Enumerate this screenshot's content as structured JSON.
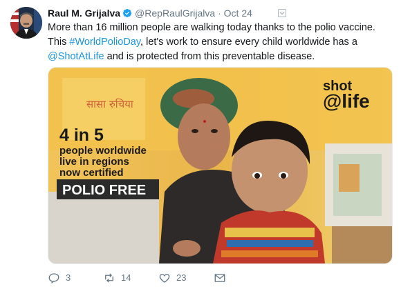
{
  "tweet": {
    "author_name": "Raul M. Grijalva",
    "handle": "@RepRaulGrijalva",
    "separator": "·",
    "date": "Oct 24",
    "text_1": "More than 16 million people are walking today thanks to the polio vaccine. This ",
    "hashtag": "#WorldPolioDay",
    "text_2": ", let's work to ensure every child worldwide has a ",
    "mention": "@ShotAtLife",
    "text_3": " and is protected from this preventable disease."
  },
  "media": {
    "brand_line1": "shot",
    "brand_line2": "@life",
    "stat_big": "4 in 5",
    "stat_line1": "people worldwide",
    "stat_line2": "live in regions",
    "stat_line3": "now certified",
    "stat_badge": "POLIO FREE",
    "banner_text": "सासा रुचिया"
  },
  "actions": {
    "reply_count": "3",
    "retweet_count": "14",
    "like_count": "23"
  },
  "colors": {
    "link": "#1b95e0",
    "muted": "#657786",
    "verified": "#1da1f2"
  }
}
